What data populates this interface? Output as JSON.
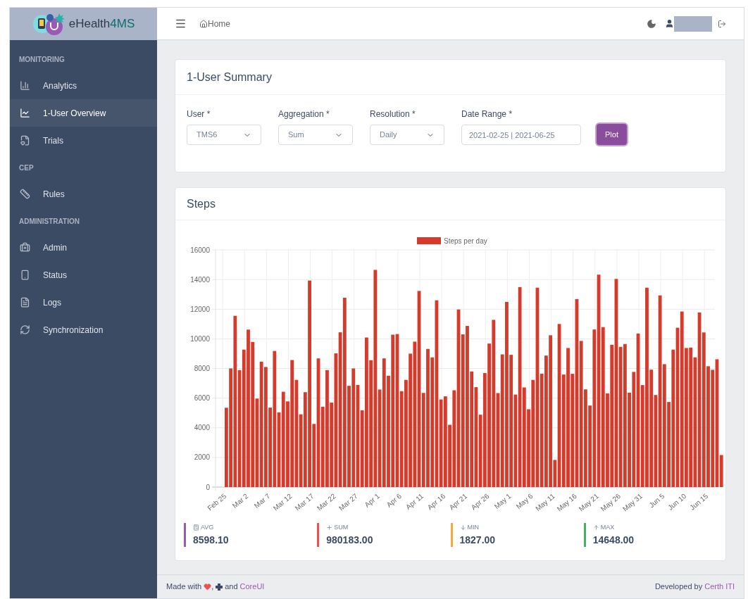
{
  "brand": {
    "name": "eHealth",
    "suffix": "4MS"
  },
  "header": {
    "breadcrumb": "Home"
  },
  "sidebar": {
    "sections": [
      {
        "title": "MONITORING",
        "items": [
          {
            "label": "Analytics",
            "selected": false
          },
          {
            "label": "1-User Overview",
            "selected": true
          },
          {
            "label": "Trials",
            "selected": false
          }
        ]
      },
      {
        "title": "CEP",
        "items": [
          {
            "label": "Rules",
            "selected": false
          }
        ]
      },
      {
        "title": "ADMINISTRATION",
        "items": [
          {
            "label": "Admin",
            "selected": false
          },
          {
            "label": "Status",
            "selected": false
          },
          {
            "label": "Logs",
            "selected": false
          },
          {
            "label": "Synchronization",
            "selected": false
          }
        ]
      }
    ]
  },
  "summary": {
    "title": "1-User Summary",
    "fields": [
      {
        "kind": "select",
        "label": "User *",
        "value": "TMS6"
      },
      {
        "kind": "select",
        "label": "Aggregation *",
        "value": "Sum"
      },
      {
        "kind": "select",
        "label": "Resolution *",
        "value": "Daily"
      },
      {
        "kind": "input",
        "label": "Date Range *",
        "value": "2021-02-25 | 2021-06-25"
      }
    ],
    "button": "Plot"
  },
  "steps": {
    "title": "Steps",
    "chart_data": {
      "type": "bar",
      "yticks": [
        0,
        2000,
        4000,
        6000,
        8000,
        10000,
        12000,
        14000,
        16000
      ],
      "ylim": [
        0,
        16000
      ],
      "grid": true,
      "categories": [
        "Feb 25",
        null,
        null,
        null,
        null,
        "Mar 2",
        null,
        null,
        null,
        null,
        "Mar 7",
        null,
        null,
        null,
        null,
        "Mar 12",
        null,
        null,
        null,
        null,
        "Mar 17",
        null,
        null,
        null,
        null,
        "Mar 22",
        null,
        null,
        null,
        null,
        "Mar 27",
        null,
        null,
        null,
        null,
        "Apr 1",
        null,
        null,
        null,
        null,
        "Apr 6",
        null,
        null,
        null,
        null,
        "Apr 11",
        null,
        null,
        null,
        null,
        "Apr 16",
        null,
        null,
        null,
        null,
        "Apr 21",
        null,
        null,
        null,
        null,
        "Apr 26",
        null,
        null,
        null,
        null,
        "May 1",
        null,
        null,
        null,
        null,
        "May 6",
        null,
        null,
        null,
        null,
        "May 11",
        null,
        null,
        null,
        null,
        "May 16",
        null,
        null,
        null,
        null,
        "May 21",
        null,
        null,
        null,
        null,
        "May 26",
        null,
        null,
        null,
        null,
        "May 31",
        null,
        null,
        null,
        null,
        "Jun 5",
        null,
        null,
        null,
        null,
        "Jun 10",
        null,
        null,
        null,
        null,
        "Jun 15",
        null,
        null,
        null
      ],
      "series": [
        {
          "name": "Steps per day",
          "color": "#d63a2b",
          "values": [
            5350,
            8000,
            11550,
            7890,
            9270,
            10620,
            9790,
            5970,
            8460,
            8100,
            5360,
            9180,
            5040,
            6430,
            5780,
            8570,
            7230,
            4910,
            6400,
            13930,
            4260,
            8680,
            5420,
            7890,
            5700,
            9020,
            10440,
            12770,
            6830,
            8000,
            6890,
            5180,
            10090,
            8560,
            14650,
            6580,
            8680,
            7510,
            10280,
            10320,
            6470,
            7230,
            9000,
            9810,
            13230,
            6350,
            9320,
            8750,
            12600,
            5910,
            6120,
            4200,
            6530,
            11980,
            10300,
            10870,
            7800,
            6740,
            4880,
            7690,
            9680,
            11280,
            6340,
            8950,
            12490,
            8920,
            6240,
            13490,
            6720,
            5250,
            7230,
            13450,
            7650,
            8870,
            10240,
            1830,
            11000,
            7590,
            9380,
            7640,
            12680,
            9860,
            6590,
            5500,
            10630,
            14330,
            10790,
            6320,
            9600,
            14040,
            9460,
            9650,
            6370,
            7770,
            10360,
            6880,
            13450,
            7920,
            6210,
            12930,
            8290,
            5740,
            9270,
            10750,
            11840,
            9380,
            9410,
            8750,
            11780,
            10430,
            8150,
            7910,
            8620,
            2160
          ]
        }
      ]
    },
    "stats": [
      {
        "kind": "avg",
        "label": "AVG",
        "value": "8598.10",
        "color": "#9b59b6"
      },
      {
        "kind": "sum",
        "label": "SUM",
        "value": "980183.00",
        "color": "#e55353"
      },
      {
        "kind": "min",
        "label": "MIN",
        "value": "1827.00",
        "color": "#f0ad3e"
      },
      {
        "kind": "max",
        "label": "MAX",
        "value": "14648.00",
        "color": "#3fb45f"
      }
    ]
  },
  "footer": {
    "prefix": "Made with",
    "separator": ",",
    "conjunction": "and",
    "link": "CoreUI",
    "right_text": "Developed by",
    "right_link": "Certh ITI"
  }
}
